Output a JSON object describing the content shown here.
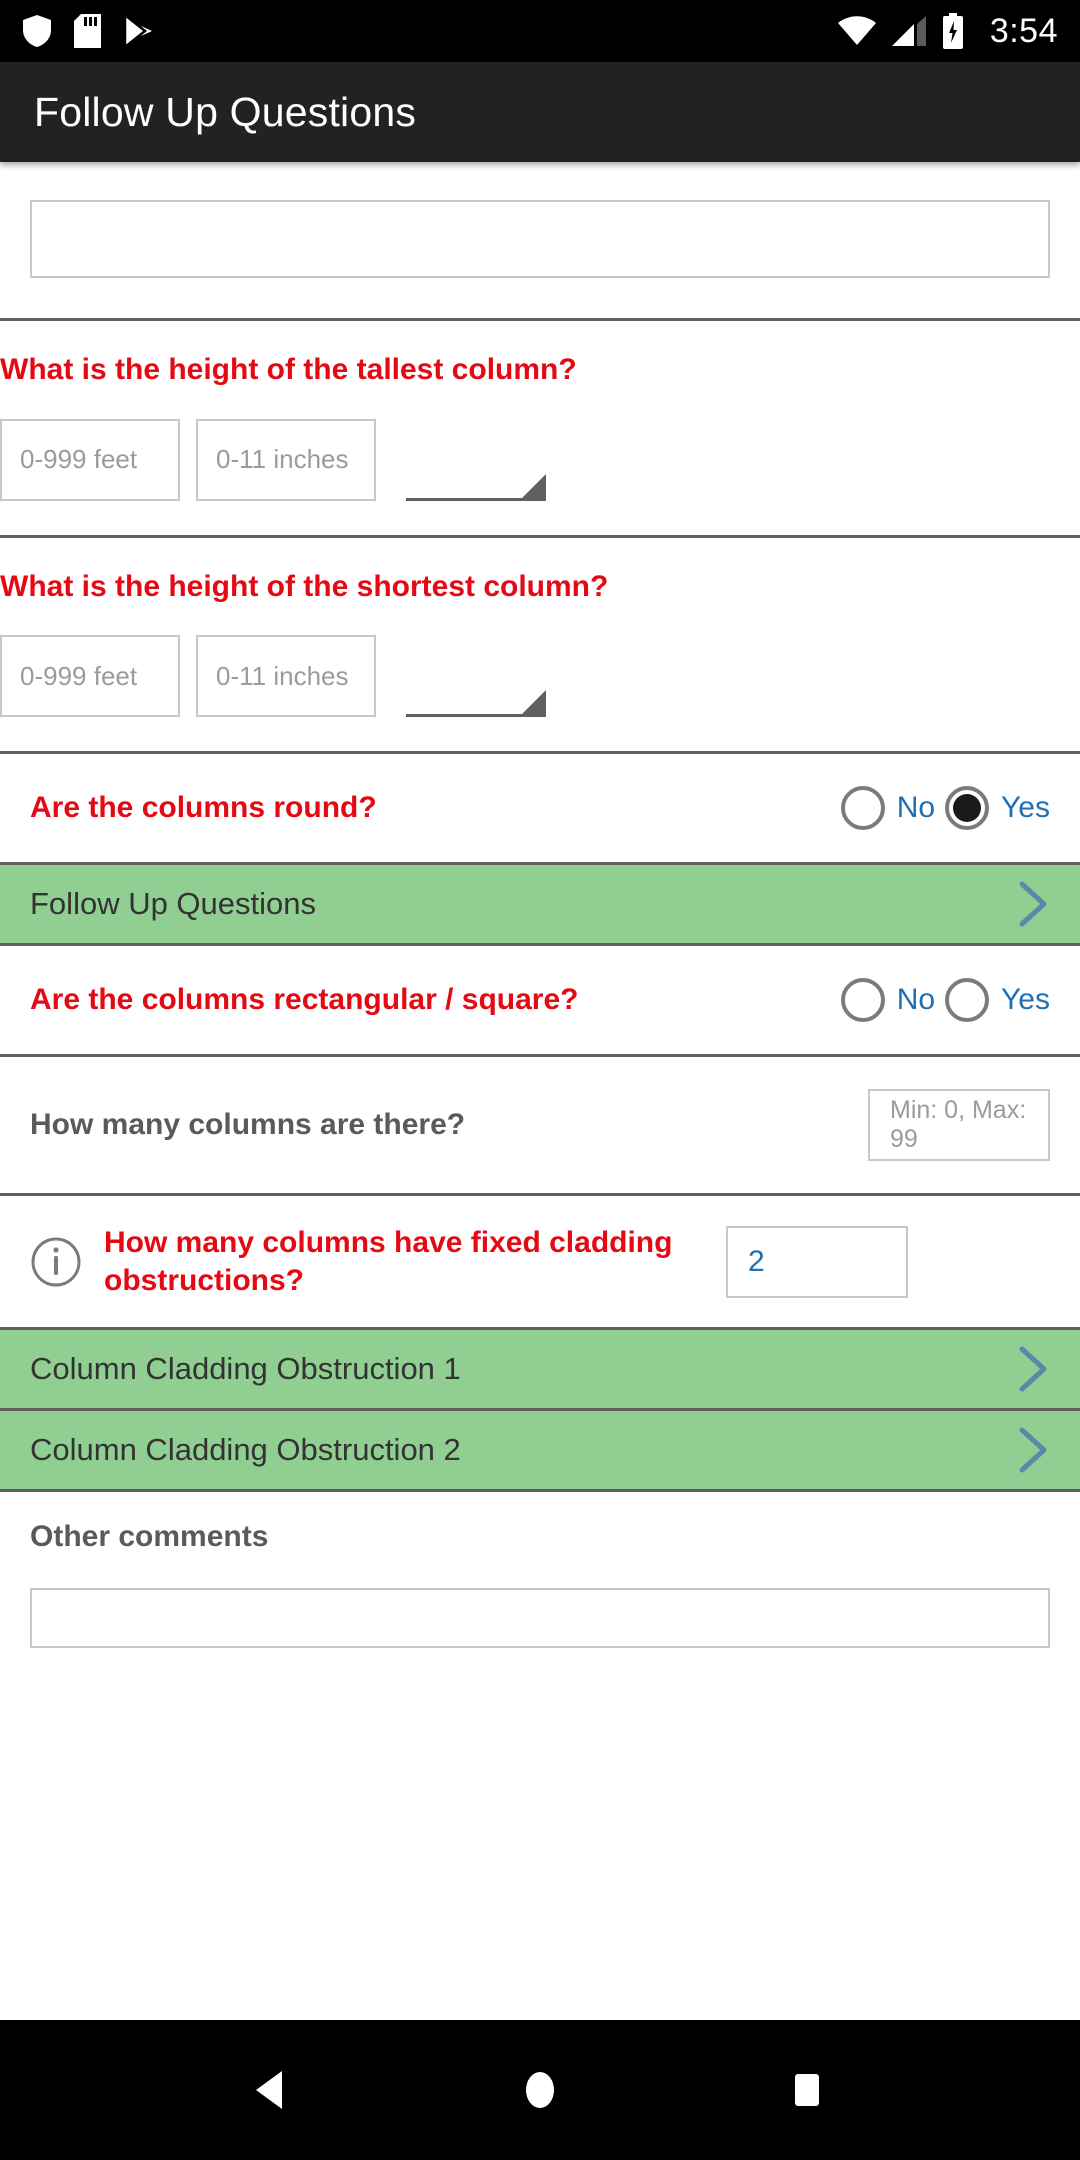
{
  "status_bar": {
    "time": "3:54",
    "left_icons": [
      "shield-icon",
      "sd-card-icon",
      "play-store-icon"
    ],
    "right_icons": [
      "wifi-icon",
      "cellular-signal-icon",
      "battery-charging-icon"
    ]
  },
  "app_bar": {
    "title": "Follow Up Questions"
  },
  "form": {
    "top_text_field": {
      "value": "",
      "placeholder": ""
    },
    "tallest_column": {
      "question": "What is the height of the tallest column?",
      "feet_placeholder": "0-999 feet",
      "feet_value": "",
      "inches_placeholder": "0-11 inches",
      "inches_value": "",
      "spinner_value": ""
    },
    "shortest_column": {
      "question": "What is the height of the shortest column?",
      "feet_placeholder": "0-999 feet",
      "feet_value": "",
      "inches_placeholder": "0-11 inches",
      "inches_value": "",
      "spinner_value": ""
    },
    "columns_round": {
      "question": "Are the columns round?",
      "no_label": "No",
      "yes_label": "Yes",
      "selected": "Yes"
    },
    "follow_up_link": {
      "label": "Follow Up Questions"
    },
    "columns_rectangular": {
      "question": "Are the columns rectangular / square?",
      "no_label": "No",
      "yes_label": "Yes",
      "selected": ""
    },
    "columns_count": {
      "question": "How many columns are there?",
      "placeholder": "Min: 0, Max: 99",
      "value": ""
    },
    "cladding_obstructions": {
      "question": "How many columns have fixed cladding obstructions?",
      "value": "2",
      "has_info_icon": true
    },
    "obstruction_links": [
      {
        "label": "Column Cladding Obstruction 1"
      },
      {
        "label": "Column Cladding Obstruction 2"
      }
    ],
    "other_comments": {
      "label": "Other comments",
      "value": "",
      "placeholder": ""
    }
  },
  "nav_bar": {
    "back": "back-triangle-icon",
    "home": "home-circle-icon",
    "recents": "recents-square-icon"
  },
  "colors": {
    "required_red": "#e50914",
    "link_blue": "#1f6fb2",
    "row_green": "#90cf91",
    "app_bar": "#222222",
    "divider": "#5f5f5f"
  }
}
